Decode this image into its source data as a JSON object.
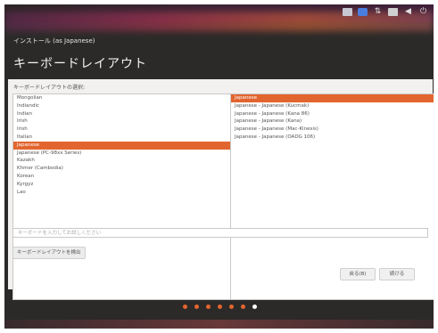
{
  "colors": {
    "accent": "#e2652f",
    "dark_background": "#2b2a28",
    "panel": "#f2f1f0"
  },
  "top_panel": {
    "indicators": [
      "keyboard-icon",
      "bluetooth-icon",
      "network-icon",
      "battery-icon",
      "volume-icon",
      "power-icon"
    ]
  },
  "window": {
    "title": "インストール (as Japanese)",
    "page_title": "キーボードレイアウト"
  },
  "layout_section": {
    "label": "キーボードレイアウトの選択:",
    "layouts": [
      {
        "label": "Mongolian",
        "selected": false
      },
      {
        "label": "Indiandic",
        "selected": false
      },
      {
        "label": "Indian",
        "selected": false
      },
      {
        "label": "Irish",
        "selected": false
      },
      {
        "label": "Irish",
        "selected": false
      },
      {
        "label": "Italian",
        "selected": false
      },
      {
        "label": "Japanese",
        "selected": true
      },
      {
        "label": "Japanese (PC-98xx Series)",
        "selected": false
      },
      {
        "label": "Kazakh",
        "selected": false
      },
      {
        "label": "Khmer (Cambodia)",
        "selected": false
      },
      {
        "label": "Korean",
        "selected": false
      },
      {
        "label": "Kyrgyz",
        "selected": false
      },
      {
        "label": "Lao",
        "selected": false
      }
    ],
    "variants": [
      {
        "label": "Japanese",
        "selected": true
      },
      {
        "label": "Japanese - Japanese (Kucmak)",
        "selected": false
      },
      {
        "label": "Japanese - Japanese (Kana 86)",
        "selected": false
      },
      {
        "label": "Japanese - Japanese (Kana)",
        "selected": false
      },
      {
        "label": "Japanese - Japanese (Mac-Kinesis)",
        "selected": false
      },
      {
        "label": "Japanese - Japanese (OADG 106)",
        "selected": false
      }
    ]
  },
  "test_input": {
    "placeholder": "キーボードを入力してお試しください"
  },
  "detect_button": {
    "label": "キーボードレイアウトを検出"
  },
  "navigation": {
    "back_label": "戻る(B)",
    "next_label": "続ける"
  },
  "progress": {
    "total_steps": 7,
    "current_step": 7
  }
}
